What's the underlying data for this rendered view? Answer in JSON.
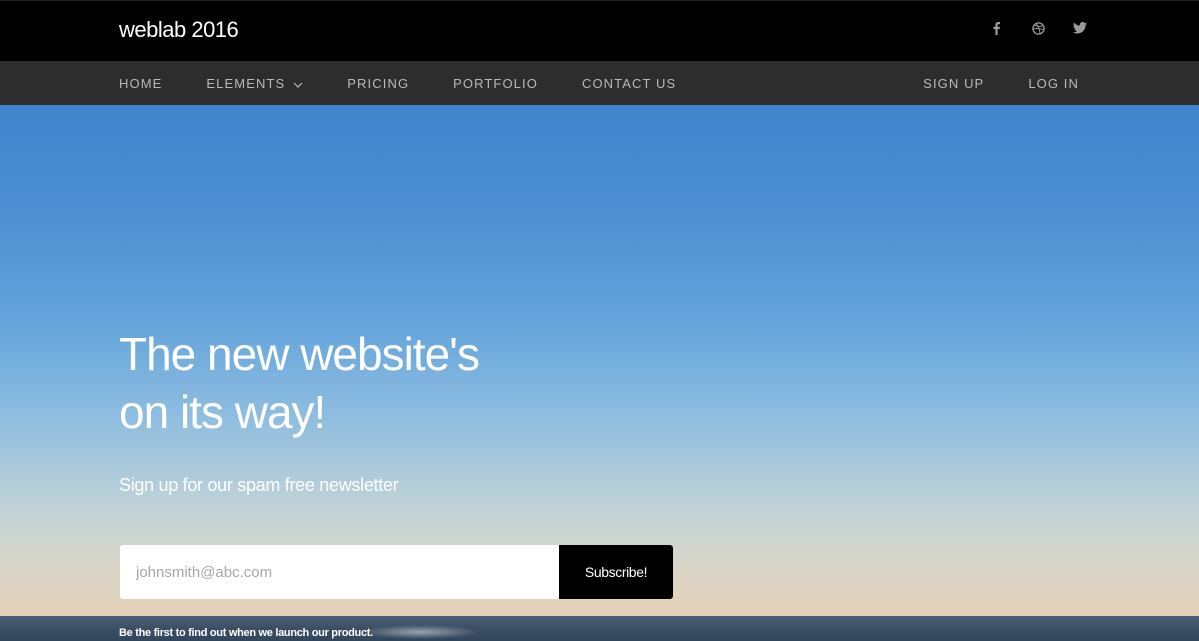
{
  "brand": {
    "title": "weblab 2016"
  },
  "social": {
    "icons": [
      "facebook-icon",
      "dribbble-icon",
      "twitter-icon"
    ],
    "color": "#9a9a9a"
  },
  "nav": {
    "left": [
      "HOME",
      "ELEMENTS",
      "PRICING",
      "PORTFOLIO",
      "CONTACT US"
    ],
    "right": [
      "SIGN UP",
      "LOG IN"
    ]
  },
  "hero": {
    "headline_line1": "The new website's",
    "headline_line2": "on its way!",
    "subline": "Sign up for our spam free newsletter",
    "email_placeholder": "johnsmith@abc.com",
    "subscribe_label": "Subscribe!",
    "footnote": "Be the first to find out when we launch our product."
  },
  "colors": {
    "topbar": "#000000",
    "navbar": "#2d2d2d",
    "nav_text": "#b9b9b9",
    "sky_top": "#3f84cc",
    "button": "#000000"
  }
}
